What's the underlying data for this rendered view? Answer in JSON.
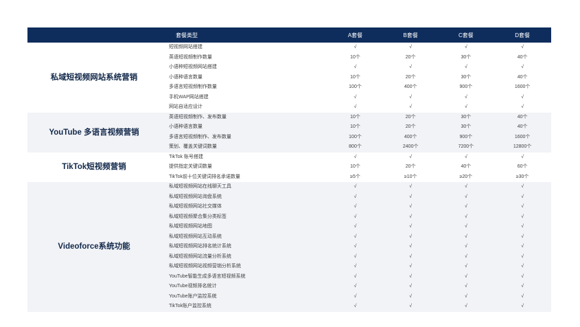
{
  "table": {
    "header": {
      "type_label": "套餐类型",
      "plans": [
        "A套餐",
        "B套餐",
        "C套餐",
        "D套餐"
      ]
    },
    "sections": [
      {
        "title": "私域短视频网站系统营销",
        "rows": [
          {
            "feature": "短视频网站搭建",
            "values": [
              "√",
              "√",
              "√",
              "√"
            ]
          },
          {
            "feature": "英语短视频制作数量",
            "values": [
              "10个",
              "20个",
              "30个",
              "40个"
            ]
          },
          {
            "feature": "小语种短视频网站搭建",
            "values": [
              "√",
              "√",
              "√",
              "√"
            ]
          },
          {
            "feature": "小语种语言数量",
            "values": [
              "10个",
              "20个",
              "30个",
              "40个"
            ]
          },
          {
            "feature": "多语言短视频制作数量",
            "values": [
              "100个",
              "400个",
              "900个",
              "1600个"
            ]
          },
          {
            "feature": "手机WAP网站搭建",
            "values": [
              "√",
              "√",
              "√",
              "√"
            ]
          },
          {
            "feature": "网站自适应设计",
            "values": [
              "√",
              "√",
              "√",
              "√"
            ]
          }
        ]
      },
      {
        "title": "YouTube 多语言视频营销",
        "rows": [
          {
            "feature": "英语短视频制作、发布数量",
            "values": [
              "10个",
              "20个",
              "30个",
              "40个"
            ]
          },
          {
            "feature": "小语种语言数量",
            "values": [
              "10个",
              "20个",
              "30个",
              "40个"
            ]
          },
          {
            "feature": "多语言短视频制作、发布数量",
            "values": [
              "100个",
              "400个",
              "900个",
              "1600个"
            ]
          },
          {
            "feature": "策划、覆盖关键词数量",
            "values": [
              "800个",
              "2400个",
              "7200个",
              "12800个"
            ]
          }
        ]
      },
      {
        "title": "TikTok短视频营销",
        "rows": [
          {
            "feature": "TikTok 账号搭建",
            "values": [
              "√",
              "√",
              "√",
              "√"
            ]
          },
          {
            "feature": "提供指定关键词数量",
            "values": [
              "10个",
              "20个",
              "40个",
              "60个"
            ]
          },
          {
            "feature": "TikTok前十位关键词排名承诺数量",
            "values": [
              "≥5个",
              "≥10个",
              "≥20个",
              "≥30个"
            ]
          }
        ]
      },
      {
        "title": "Videoforce系统功能",
        "rows": [
          {
            "feature": "私域短视频网站在线聊天工具",
            "values": [
              "√",
              "√",
              "√",
              "√"
            ]
          },
          {
            "feature": "私域短视频网站询盘系统",
            "values": [
              "√",
              "√",
              "√",
              "√"
            ]
          },
          {
            "feature": "私域短视频网站社交媒体",
            "values": [
              "√",
              "√",
              "√",
              "√"
            ]
          },
          {
            "feature": "私域短视频聚合集分类标签",
            "values": [
              "√",
              "√",
              "√",
              "√"
            ]
          },
          {
            "feature": "私域短视频网站地图",
            "values": [
              "√",
              "√",
              "√",
              "√"
            ]
          },
          {
            "feature": "私域短视频网站互动系统",
            "values": [
              "√",
              "√",
              "√",
              "√"
            ]
          },
          {
            "feature": "私域短视频网站排名统计系统",
            "values": [
              "√",
              "√",
              "√",
              "√"
            ]
          },
          {
            "feature": "私域短视频网站流量分析系统",
            "values": [
              "√",
              "√",
              "√",
              "√"
            ]
          },
          {
            "feature": "私域短视频网站视频营销分析系统",
            "values": [
              "√",
              "√",
              "√",
              "√"
            ]
          },
          {
            "feature": "YouTube智能生成多语言短视频系统",
            "values": [
              "√",
              "√",
              "√",
              "√"
            ]
          },
          {
            "feature": "YouTube视频排名统计",
            "values": [
              "√",
              "√",
              "√",
              "√"
            ]
          },
          {
            "feature": "YouTube账户监控系统",
            "values": [
              "√",
              "√",
              "√",
              "√"
            ]
          },
          {
            "feature": "TikTok账户监控系统",
            "values": [
              "√",
              "√",
              "√",
              "√"
            ]
          }
        ]
      }
    ]
  },
  "colors": {
    "header_background": "#0f2d5c",
    "header_text": "#ffffff",
    "section_title": "#13294b",
    "alt_section_background": "#f2f3f7"
  }
}
